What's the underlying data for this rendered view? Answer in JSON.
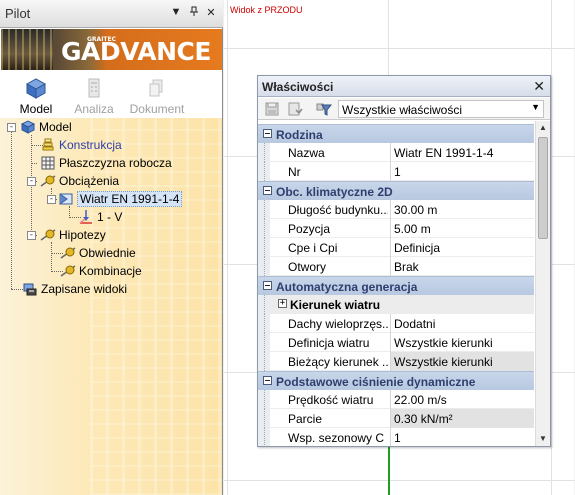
{
  "pilot": {
    "title": "Pilot",
    "buttons": {
      "menu": "▼",
      "pin": "ᵽ",
      "close": "✕"
    },
    "banner": {
      "sub": "GRAITEC",
      "brand": "GRADVANCE"
    },
    "modules": [
      {
        "label": "Model",
        "enabled": true,
        "icon": "model-icon"
      },
      {
        "label": "Analiza",
        "enabled": false,
        "icon": "analysis-icon"
      },
      {
        "label": "Dokument",
        "enabled": false,
        "icon": "document-icon"
      }
    ],
    "tree": {
      "model": "Model",
      "konstrukcja": "Konstrukcja",
      "plaszczyzna": "Płaszczyzna robocza",
      "obciazenia": "Obciążenia",
      "wiatr": "Wiatr EN 1991-1-4",
      "case": "1 - V",
      "hipotezy": "Hipotezy",
      "obwiednie": "Obwiednie",
      "kombinacje": "Kombinacje",
      "zapisane": "Zapisane widoki"
    }
  },
  "view": {
    "label": "Widok z PRZODU"
  },
  "properties": {
    "title": "Właściwości",
    "close": "✕",
    "filter": "Wszystkie właściwości",
    "categories": {
      "rodzina": "Rodzina",
      "obc": "Obc. klimatyczne 2D",
      "auto": "Automatyczna generacja",
      "kierunek": "Kierunek wiatru",
      "cisnienie": "Podstawowe ciśnienie dynamiczne"
    },
    "rows": {
      "nazwa": {
        "name": "Nazwa",
        "value": "Wiatr EN 1991-1-4"
      },
      "nr": {
        "name": "Nr",
        "value": "1"
      },
      "dlugosc": {
        "name": "Długość budynku...",
        "value": "30.00 m"
      },
      "pozycja": {
        "name": "Pozycja",
        "value": "5.00 m"
      },
      "cpe": {
        "name": "Cpe i Cpi",
        "value": "Definicja"
      },
      "otwory": {
        "name": "Otwory",
        "value": "Brak"
      },
      "dachy": {
        "name": "Dachy wieloprzęs...",
        "value": "Dodatni"
      },
      "definicja": {
        "name": "Definicja wiatru",
        "value": "Wszystkie kierunki"
      },
      "biezacy": {
        "name": "Bieżący kierunek ...",
        "value": "Wszystkie kierunki"
      },
      "predkosc": {
        "name": "Prędkość wiatru",
        "value": "22.00 m/s"
      },
      "parcie": {
        "name": "Parcie",
        "value": "0.30 kN/m²"
      },
      "wsp": {
        "name": "Wsp. sezonowy C",
        "value": "1"
      }
    }
  },
  "colors": {
    "category_text": "#2f3f6e",
    "category_bg": "#c9d6ea",
    "banner_orange": "#e67a1e",
    "link_blue": "#2d3fa8",
    "axis_green": "#1fa01f"
  }
}
